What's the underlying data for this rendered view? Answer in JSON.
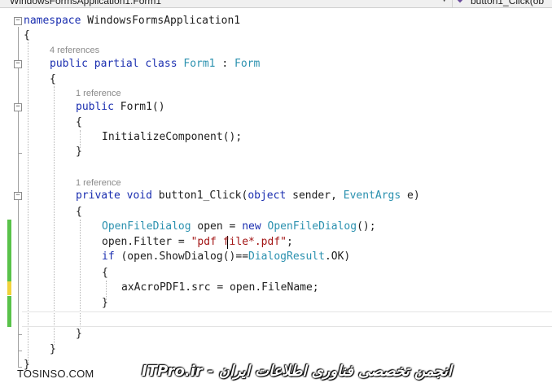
{
  "navbar": {
    "left_label": "WindowsFormsApplication1.Form1",
    "right_label": "button1_Click(ob",
    "dropdown_glyph": "▾",
    "method_icon": "method-icon"
  },
  "code": {
    "l1_kw": "namespace",
    "l1_rest": " WindowsFormsApplication1",
    "l2": "{",
    "lens1": "4 references",
    "l3_kw": "public partial class",
    "l3_type1": " Form1",
    "l3_colon": " : ",
    "l3_type2": "Form",
    "l4": "{",
    "lens2": "1 reference",
    "l5_kw": "public",
    "l5_rest": " Form1()",
    "l6": "{",
    "l7": "InitializeComponent();",
    "l8": "}",
    "lens3": "1 reference",
    "l9_kw": "private void",
    "l9_mid": " button1_Click(",
    "l9_kw2": "object",
    "l9_mid2": " sender, ",
    "l9_type": "EventArgs",
    "l9_end": " e)",
    "l10": "{",
    "l11_type": "OpenFileDialog",
    "l11_mid": " open = ",
    "l11_kw": "new",
    "l11_type2": " OpenFileDialog",
    "l11_end": "();",
    "l12_pre": "open.Filter = ",
    "l12_str1": "\"pdf file",
    "l12_str2": "*.pdf\"",
    "l12_end": ";",
    "l13_kw": "if",
    "l13_mid": " (open.ShowDialog()==",
    "l13_type": "DialogResult",
    "l13_end": ".OK)",
    "l14": "{",
    "l15": "axAcroPDF1.src = open.FileName;",
    "l16": "}",
    "l17": "}",
    "l18": "}",
    "l19": "}"
  },
  "fold_glyph": "−",
  "watermark": {
    "left": "TOSINSO.COM",
    "right": "ITPro.ir - انجمن تخصصی فناوری اطلاعات ایران"
  },
  "colors": {
    "keyword": "#1b2fb0",
    "type": "#2b91af",
    "string": "#a31515",
    "change_saved": "#59c24a",
    "change_unsaved": "#f1d23a"
  }
}
